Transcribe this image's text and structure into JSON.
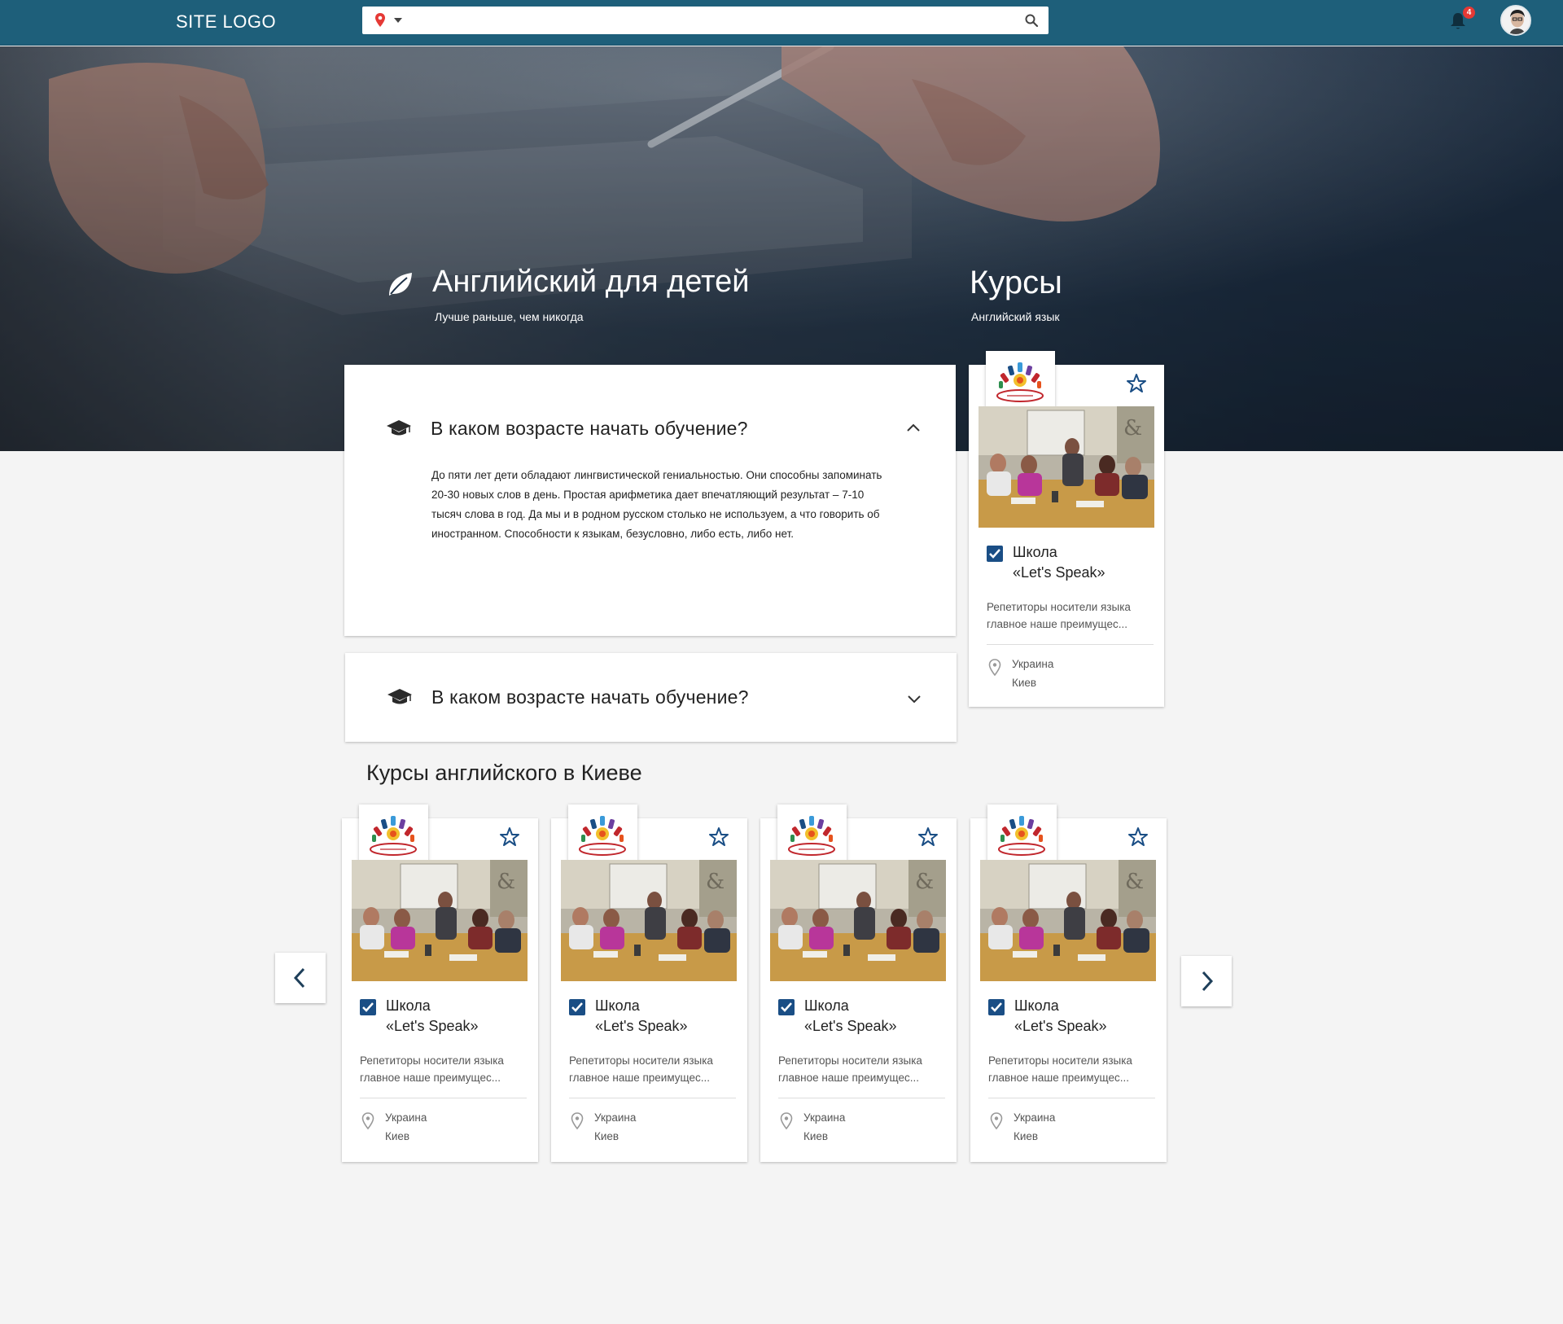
{
  "header": {
    "logo": "SITE LOGO",
    "search_placeholder": "",
    "notifications_count": "4",
    "icons": [
      "location-pin-icon",
      "caret-down-icon",
      "search-icon",
      "bell-icon",
      "avatar"
    ]
  },
  "hero": {
    "title": "Английский для детей",
    "subtitle": "Лучше раньше, чем никогда",
    "right_title": "Курсы",
    "right_subtitle": "Английский язык"
  },
  "faq": [
    {
      "question": "В каком возрасте начать обучение?",
      "expanded": true,
      "answer": "До пяти лет дети обладают лингвистической гениальностью. Они способны запоминать 20-30 новых слов в день. Простая арифметика дает впечатляющий результат – 7-10 тысяч слова в год. Да мы и в родном русском столько не используем, а что говорить об иностранном. Способности к языкам, безусловно, либо есть, либо нет."
    },
    {
      "question": "В каком возрасте начать обучение?",
      "expanded": false,
      "answer": ""
    }
  ],
  "featured_card": {
    "name_line1": "Школа",
    "name_line2": "«Let's Speak»",
    "description": "Репетиторы носители языка главное наше преимущес...",
    "country": "Украина",
    "city": "Киев"
  },
  "section": {
    "title": "Курсы английского в Киеве"
  },
  "cards": [
    {
      "name_line1": "Школа",
      "name_line2": "«Let's Speak»",
      "description": "Репетиторы носители языка главное наше преимущес...",
      "country": "Украина",
      "city": "Киев"
    },
    {
      "name_line1": "Школа",
      "name_line2": "«Let's Speak»",
      "description": "Репетиторы носители языка главное наше преимущес...",
      "country": "Украина",
      "city": "Киев"
    },
    {
      "name_line1": "Школа",
      "name_line2": "«Let's Speak»",
      "description": "Репетиторы носители языка главное наше преимущес...",
      "country": "Украина",
      "city": "Киев"
    },
    {
      "name_line1": "Школа",
      "name_line2": "«Let's Speak»",
      "description": "Репетиторы носители языка главное наше преимущес...",
      "country": "Украина",
      "city": "Киев"
    }
  ],
  "colors": {
    "header_bg": "#1e5f7a",
    "accent_blue": "#1a4e85",
    "badge_red": "#e53935",
    "page_bg": "#f4f4f4"
  }
}
